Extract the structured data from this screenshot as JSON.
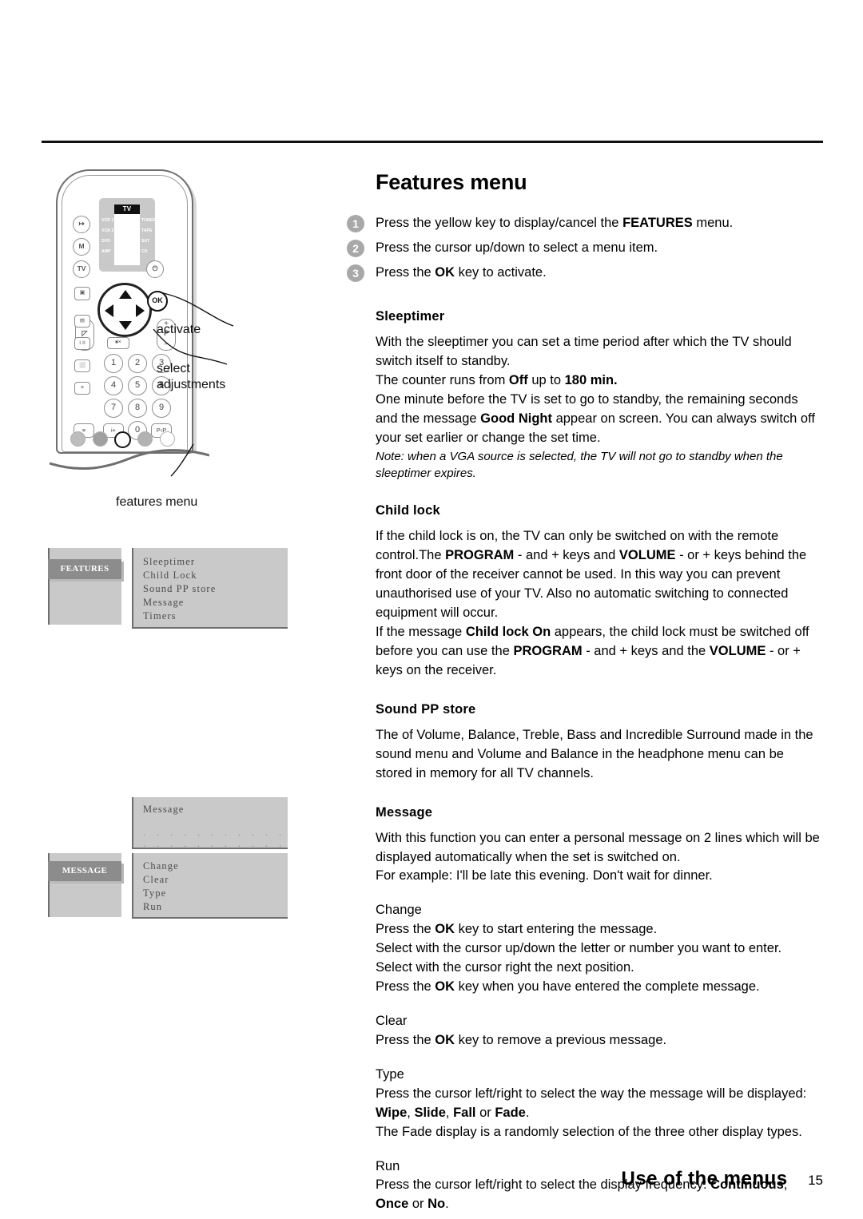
{
  "header": {
    "rule": true
  },
  "main": {
    "title": "Features menu",
    "steps": [
      {
        "num": "1",
        "html": "Press the yellow key to display/cancel the <b>FEATURES</b> menu."
      },
      {
        "num": "2",
        "html": "Press the cursor up/down to select a menu item."
      },
      {
        "num": "3",
        "html": "Press the <b>OK</b> key to activate."
      }
    ],
    "sections": [
      {
        "heading": "Sleeptimer",
        "body": "With the sleeptimer you can set a time period after which the TV should switch itself to standby.<br>The counter runs from <b>Off</b> up to <b>180 min.</b><br>One minute before the TV is set to go to standby, the remaining seconds and the message <b>Good Night</b> appear on screen. You can always switch off your set earlier or change the set time.",
        "note": "Note: when a VGA source is selected, the TV will not go to standby when the sleeptimer expires."
      },
      {
        "heading": "Child lock",
        "body": "If the child lock is on, the TV can only be switched on with the remote control.The <b>PROGRAM</b> - and + keys and <b>VOLUME</b> - or + keys behind the front door of the receiver cannot be used. In this way you can prevent unauthorised use of your TV. Also no automatic switching to connected equipment will occur.<br>If the message <b>Child lock On</b> appears, the child lock must be switched off before you can use the <b>PROGRAM</b> - and + keys and the <b>VOLUME</b> - or + keys on the receiver."
      },
      {
        "heading": "Sound PP store",
        "body": "The of Volume, Balance, Treble, Bass and Incredible Surround made in the sound menu and Volume and Balance in the headphone menu can be stored in memory for all TV channels."
      },
      {
        "heading": "Message",
        "body": "With this function you can enter a personal message on 2 lines which will be displayed automatically when the set is switched on.<br>For example: I'll be late this evening. Don't wait for dinner."
      }
    ],
    "subsections": [
      {
        "heading": "Change",
        "body": "Press the <b>OK</b> key to start entering the message.<br>Select with the cursor up/down the letter or number you want to enter.<br>Select with the cursor right the next position.<br>Press the <b>OK</b> key when you have entered the complete message."
      },
      {
        "heading": "Clear",
        "body": "Press the <b>OK</b> key to remove a previous message."
      },
      {
        "heading": "Type",
        "body": "Press the cursor left/right to select the way the message will be displayed:<br><b>Wipe</b>, <b>Slide</b>, <b>Fall</b> or <b>Fade</b>.<br>The Fade display is a randomly selection of the three other display types."
      },
      {
        "heading": "Run",
        "body": "Press the cursor left/right to select the display frequency: <b>Continuous</b>, <b>Once</b> or <b>No</b>."
      }
    ]
  },
  "remote": {
    "lcd": {
      "selected": "TV",
      "left_labels": [
        "VCR 1",
        "VCR 2",
        "DVD",
        "AMP"
      ],
      "right_labels": [
        "TUNER",
        "TAPE",
        "SAT",
        "CD"
      ]
    },
    "side_buttons": [
      {
        "name": "source-button",
        "glyph": "↦"
      },
      {
        "name": "menu-m-button",
        "glyph": "M"
      },
      {
        "name": "tv-button",
        "glyph": "TV"
      },
      {
        "name": "pip-button",
        "glyph": "▣"
      }
    ],
    "power_glyph": "⏻",
    "ok_label": "OK",
    "volume_rocker": {
      "plus": "+",
      "minus": "−",
      "mid": "◸"
    },
    "program_rocker": {
      "plus": "+",
      "minus": "−",
      "mid": "P"
    },
    "mute_glyph": "⏹×",
    "function_keys": [
      "▤",
      "I·II",
      "⬜",
      "≡"
    ],
    "numeric_keys": [
      "1",
      "2",
      "3",
      "4",
      "5",
      "6",
      "7",
      "8",
      "9"
    ],
    "bottom_keys": [
      "≡",
      "i+",
      "0",
      "P‹P"
    ],
    "color_keys": [
      {
        "name": "red-key",
        "color": "#bdbdbd",
        "highlight": false
      },
      {
        "name": "green-key",
        "color": "#a0a0a0",
        "highlight": false
      },
      {
        "name": "yellow-key",
        "color": "#ffffff",
        "highlight": true
      },
      {
        "name": "blue-key",
        "color": "#b2b2b2",
        "highlight": false
      },
      {
        "name": "white-key",
        "color": "#ffffff",
        "highlight": false
      }
    ],
    "callouts": {
      "activate": "activate",
      "select_line1": "select",
      "select_line2": "adjustments",
      "features_menu": "features menu"
    }
  },
  "osd": {
    "features": {
      "tab": "FEATURES",
      "items": [
        "Sleeptimer",
        "Child Lock",
        "Sound PP store",
        "Message",
        "Timers"
      ]
    },
    "message": {
      "tab": "MESSAGE",
      "title": "Message",
      "dots_line1": ". . . . . . . . . . . . . . . . . . . . . . . . .",
      "dots_line2": ". . . . . . . . . . . . . . . . . . . . . . . . .",
      "items": [
        "Change",
        "Clear",
        "Type",
        "Run"
      ]
    }
  },
  "footer": {
    "title": "Use of the menus",
    "page": "15"
  }
}
